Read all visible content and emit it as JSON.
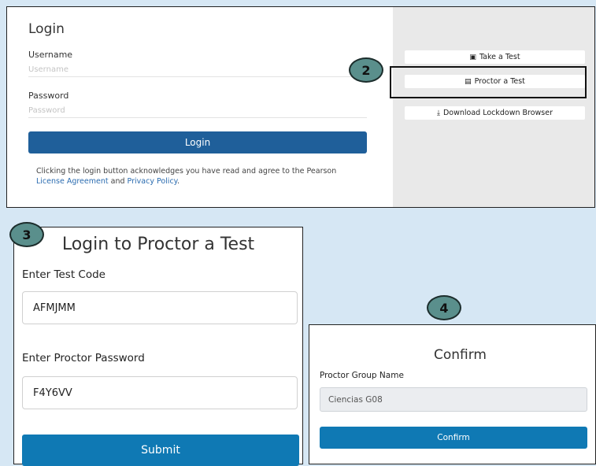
{
  "login": {
    "title": "Login",
    "username_label": "Username",
    "username_placeholder": "Username",
    "password_label": "Password",
    "password_placeholder": "Password",
    "button_label": "Login",
    "note_text": "Clicking the login button acknowledges you have read and agree to the Pearson",
    "license_link": "License Agreement",
    "and_text": "and",
    "privacy_link": "Privacy Policy",
    "period": "."
  },
  "side_menu": {
    "take_test": "Take a Test",
    "proctor_test": "Proctor a Test",
    "download_browser": "Download Lockdown Browser"
  },
  "steps": {
    "two": "2",
    "three": "3",
    "four": "4"
  },
  "proctor": {
    "title": "Login to Proctor a Test",
    "test_code_label": "Enter Test Code",
    "test_code_value": "AFMJMM",
    "password_label": "Enter Proctor Password",
    "password_value": "F4Y6VV",
    "submit_label": "Submit"
  },
  "confirm": {
    "title": "Confirm",
    "group_label": "Proctor Group Name",
    "group_value": "Ciencias G08",
    "button_label": "Confirm"
  },
  "colors": {
    "background": "#d6e7f4",
    "login_button": "#1f5f9a",
    "action_button": "#0f79b4",
    "badge": "#5a8f8c"
  }
}
